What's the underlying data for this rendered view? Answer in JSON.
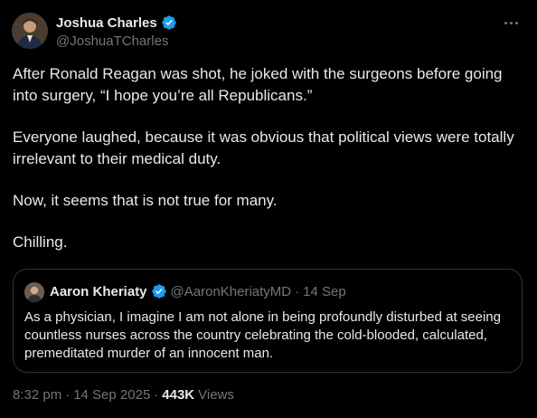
{
  "author": {
    "name": "Joshua Charles",
    "handle": "@JoshuaTCharles",
    "avatar_icon": "profile-photo",
    "verified_color": "#1d9bf0"
  },
  "tweet": {
    "paragraphs": [
      "After Ronald Reagan was shot, he joked with the surgeons before going into surgery, “I hope you’re all Republicans.”",
      "Everyone laughed, because it was obvious that political views were totally irrelevant to their medical duty.",
      "Now, it seems that is not true for many.",
      "Chilling."
    ]
  },
  "quoted_tweet": {
    "name": "Aaron Kheriaty",
    "handle": "@AaronKheriatyMD",
    "separator": "·",
    "date": "14 Sep",
    "text": "As a physician, I imagine I am not alone in being profoundly disturbed at seeing countless nurses across the country celebrating the cold-blooded, calculated, premeditated murder of an innocent man."
  },
  "meta": {
    "time": "8:32 pm",
    "sep1": "·",
    "date": "14 Sep 2025",
    "sep2": "·",
    "views_count": "443K",
    "views_label": "Views"
  }
}
